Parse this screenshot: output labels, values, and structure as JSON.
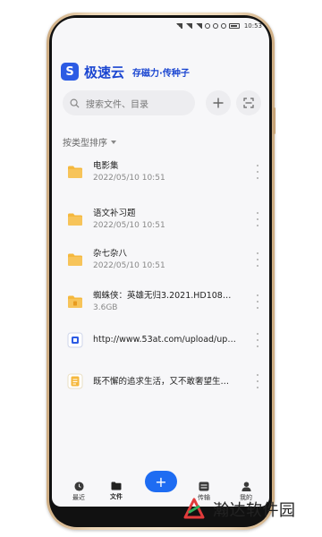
{
  "status_bar": {
    "time": "10:53"
  },
  "header": {
    "app_name": "极速云",
    "logo_letter": "S",
    "slogan": "存磁力·传种子"
  },
  "search": {
    "placeholder": "搜索文件、目录"
  },
  "sort": {
    "label": "按类型排序"
  },
  "files": [
    {
      "name": "电影集",
      "meta": "2022/05/10 10:51",
      "icon": "folder-icon"
    },
    {
      "name": "语文补习题",
      "meta": "2022/05/10 10:51",
      "icon": "folder-icon"
    },
    {
      "name": "杂七杂八",
      "meta": "2022/05/10 10:51",
      "icon": "folder-icon"
    },
    {
      "name": "蜘蛛侠：英雄无归3.2021.HD1080P....",
      "meta": "3.6GB",
      "icon": "folder-torrent-icon"
    },
    {
      "name": "http://www.53at.com/upload/up.html",
      "meta": "",
      "icon": "link-icon"
    },
    {
      "name": "既不懈的追求生活，又不敢奢望生活...",
      "meta": "",
      "icon": "document-icon"
    }
  ],
  "bottom_nav": {
    "recent": "最近",
    "files": "文件",
    "add": "+",
    "transfer": "传输",
    "mine": "我的"
  },
  "watermark": {
    "text": "瀚达软件园"
  },
  "colors": {
    "brand": "#2c5be4",
    "folder": "#f5b83d",
    "fab": "#1e6cf2"
  }
}
